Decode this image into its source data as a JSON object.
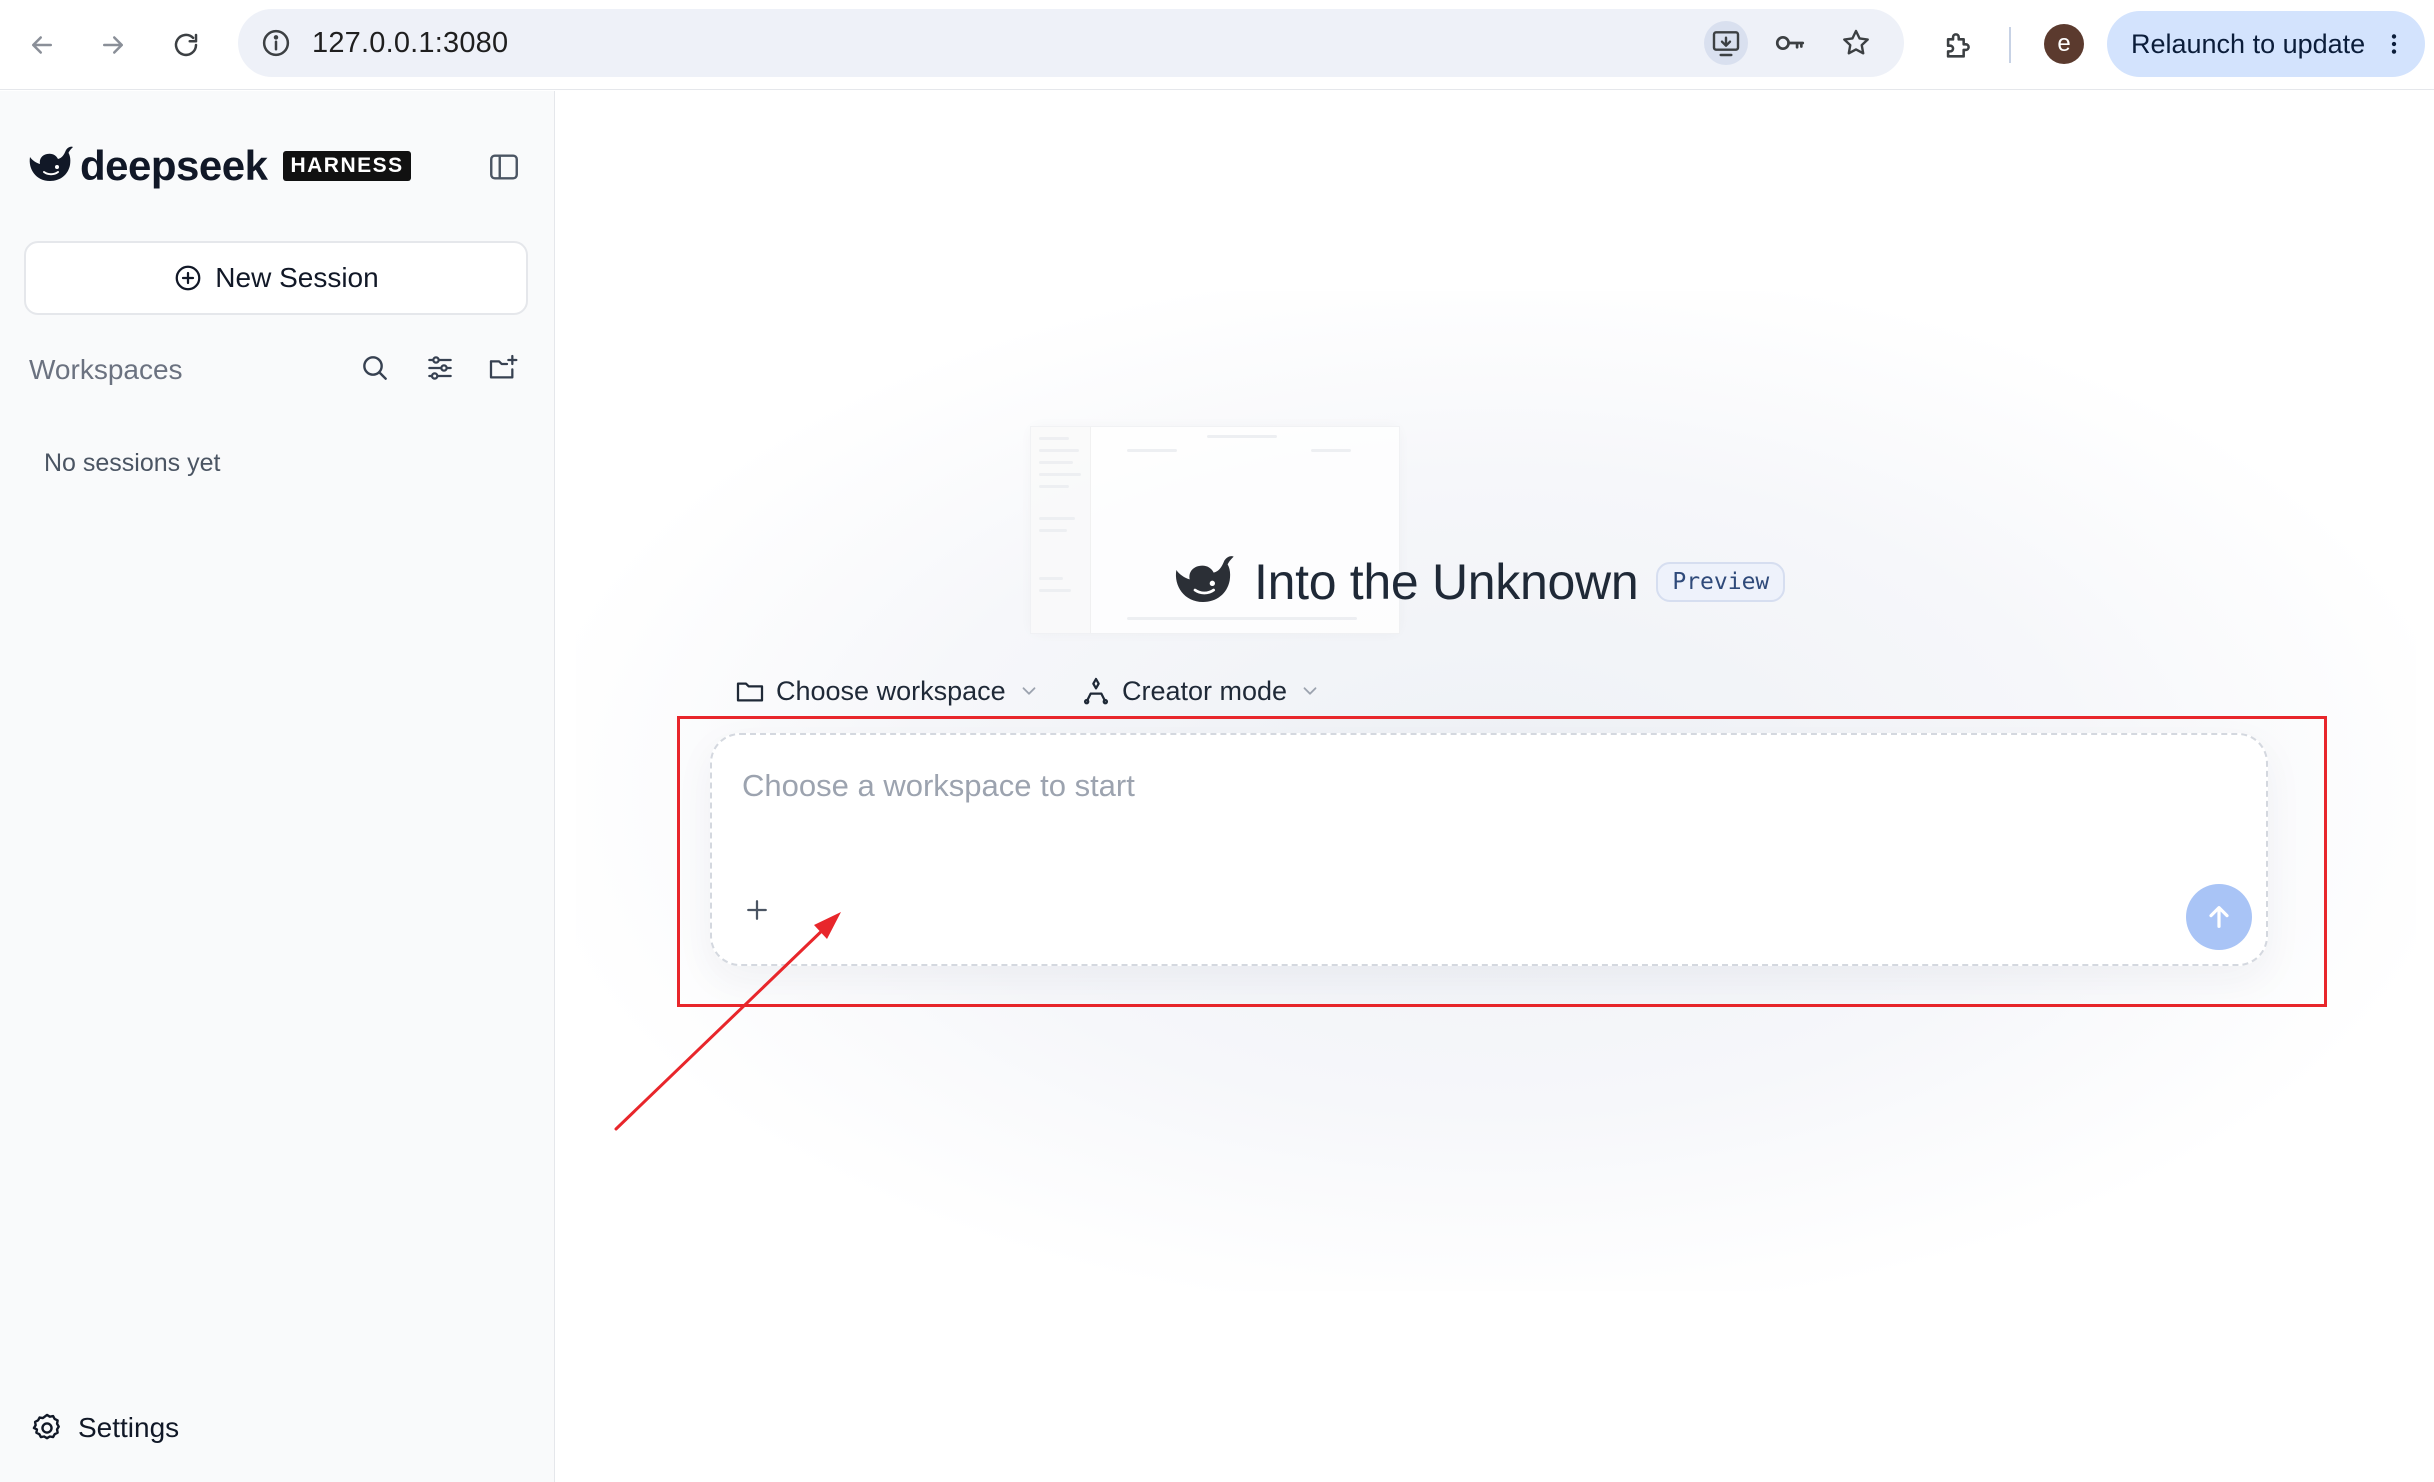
{
  "browser": {
    "url": "127.0.0.1:3080",
    "relaunch_label": "Relaunch to update",
    "profile_initial": "e",
    "icons": [
      "back-icon",
      "forward-icon",
      "reload-icon",
      "site-info-icon",
      "install-app-icon",
      "password-key-icon",
      "bookmark-star-icon",
      "extensions-icon",
      "more-vert-icon"
    ]
  },
  "sidebar": {
    "brand_name": "deepseek",
    "brand_badge": "HARNESS",
    "new_session_label": "New Session",
    "workspaces_label": "Workspaces",
    "empty_text": "No sessions yet",
    "settings_label": "Settings"
  },
  "main": {
    "title": "Into the Unknown",
    "badge": "Preview",
    "workspace_selector": "Choose workspace",
    "mode_selector": "Creator mode",
    "composer_placeholder": "Choose a workspace to start"
  },
  "colors": {
    "annotation": "#e8262b",
    "send_button": "#a9c4f6",
    "relaunch_pill": "#d3e3fd",
    "omnibox": "#eef1f8"
  }
}
